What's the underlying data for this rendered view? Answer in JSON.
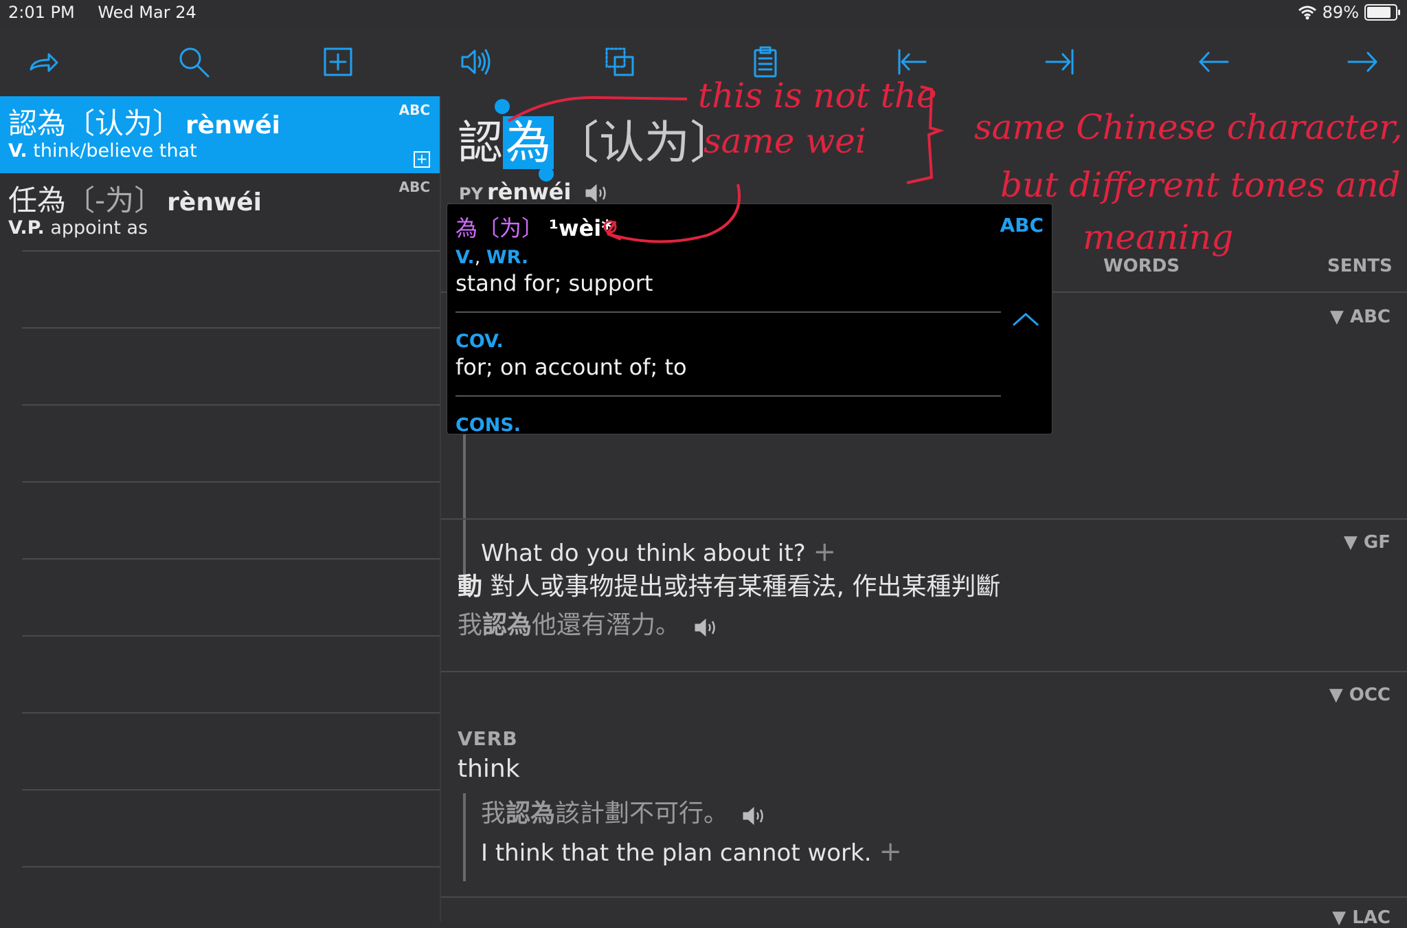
{
  "status": {
    "time": "2:01 PM",
    "date": "Wed Mar 24",
    "battery": "89%"
  },
  "toolbar": {
    "items": [
      "share-icon",
      "search-icon",
      "add-flashcard-icon",
      "speaker-icon",
      "copy-icon",
      "clipboard-icon",
      "first-icon",
      "last-icon",
      "back-icon",
      "forward-icon"
    ]
  },
  "list": [
    {
      "trad": "認為",
      "simp": "〔认为〕",
      "pinyin": "rènwéi",
      "pos": "V.",
      "def": "think/believe that",
      "badge": "ABC"
    },
    {
      "trad": "任為",
      "simp": "〔-为〕",
      "pinyin": "rènwéi",
      "pos": "V.P.",
      "def": "appoint as",
      "badge": "ABC"
    }
  ],
  "entry": {
    "char1": "認",
    "char2_selected": "為",
    "simp": "〔认为〕",
    "py_label": "PY",
    "pinyin": "rènwéi",
    "tabs": {
      "words": "WORDS",
      "sents": "SENTS"
    },
    "abc": {
      "badge": "▼ ABC",
      "example_en": "What do you think about it?",
      "plus": "+"
    },
    "gf": {
      "badge": "▼ GF",
      "pos": "動",
      "def": "對人或事物提出或持有某種看法, 作出某種判斷",
      "ex_pre": "我",
      "ex_bold": "認為",
      "ex_post": "他還有潛力。"
    },
    "occ": {
      "badge": "▼ OCC",
      "label": "VERB",
      "def": "think",
      "ex_pre": "我",
      "ex_bold": "認為",
      "ex_post": "該計劃不可行。",
      "example_en": "I think that the plan cannot work.",
      "plus": "+"
    },
    "lac_badge": "▼ LAC"
  },
  "popup": {
    "zh": "為〔为〕",
    "pinyin": "¹wèi*",
    "badge": "ABC",
    "senses": [
      {
        "pos": "V.",
        "pos2": "WR.",
        "def": "stand for; support"
      },
      {
        "pos": "COV.",
        "def": "for; on account of; to"
      },
      {
        "pos": "CONS."
      }
    ]
  },
  "annotation": {
    "line1": "this is not the",
    "line2": "same wei",
    "line3": "same Chinese character,",
    "line4": "but different tones and",
    "line5": "meaning"
  },
  "colors": {
    "accent": "#0c9ff0",
    "ink": "#e0243f",
    "popup_head": "#d26bff"
  }
}
